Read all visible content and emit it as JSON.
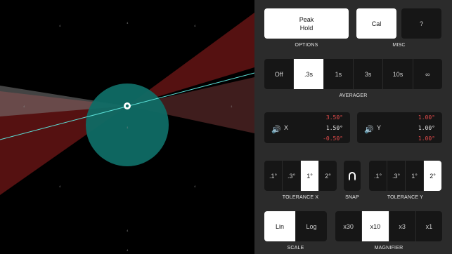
{
  "options_button": "Peak\nHold",
  "options_caption": "OPTIONS",
  "misc": {
    "cal_label": "Cal",
    "help_label": "?",
    "caption": "MISC"
  },
  "averager": {
    "options": [
      "Off",
      ".3s",
      "1s",
      "3s",
      "10s",
      "∞"
    ],
    "selected": 1,
    "caption": "AVERAGER"
  },
  "readout_x": {
    "axis": "X",
    "max": "3.50°",
    "current": "1.50°",
    "min": "-0.50°"
  },
  "readout_y": {
    "axis": "Y",
    "max": "1.00°",
    "current": "1.00°",
    "min": "1.00°"
  },
  "tolerance_x": {
    "options": [
      ".1°",
      ".3°",
      "1°",
      "2°"
    ],
    "selected": 2,
    "caption": "TOLERANCE X"
  },
  "snap": {
    "caption": "SNAP",
    "icon": "magnet-icon"
  },
  "tolerance_y": {
    "options": [
      ".1°",
      ".3°",
      "1°",
      "2°"
    ],
    "selected": 3,
    "caption": "TOLERANCE Y"
  },
  "scale": {
    "options": [
      "Lin",
      "Log"
    ],
    "selected": 0,
    "caption": "SCALE"
  },
  "magnifier": {
    "options": [
      "x30",
      "x10",
      "x3",
      "x1"
    ],
    "selected": 1,
    "caption": "MAGNIFIER"
  },
  "grid_labels": [
    "4",
    "4",
    "4",
    "4",
    "1",
    "1",
    "4",
    "4",
    "4",
    "4"
  ],
  "colors": {
    "panel": "#2b2b2b",
    "target_circle": "#0f6b65",
    "tolerance_band": "#6a1515",
    "marker_line": "#5ce0d8"
  }
}
